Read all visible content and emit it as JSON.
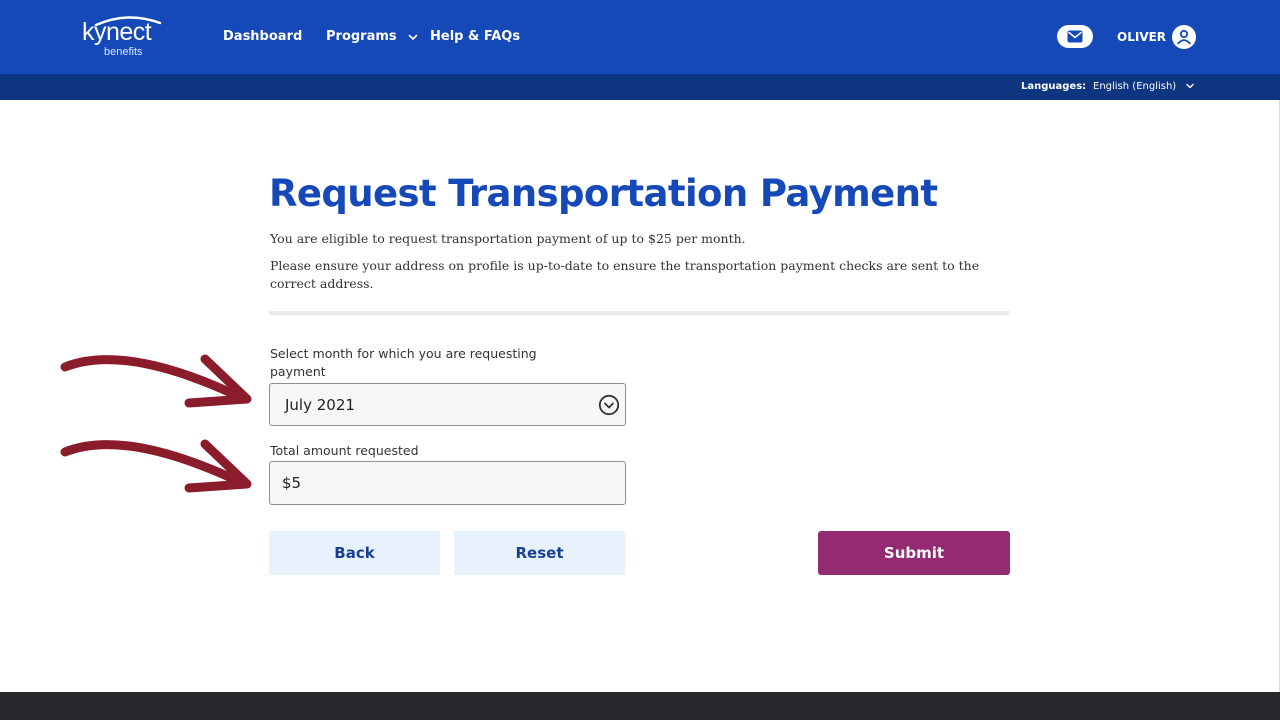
{
  "brand": {
    "name": "kynect",
    "sub": "benefits"
  },
  "nav": {
    "dashboard": "Dashboard",
    "programs": "Programs",
    "help": "Help & FAQs"
  },
  "user": {
    "name": "OLIVER"
  },
  "language": {
    "label": "Languages:",
    "selected": "English (English)"
  },
  "page": {
    "title": "Request Transportation Payment",
    "description_1": "You are eligible to request transportation payment of up to $25 per month.",
    "description_2": "Please ensure your address on profile is up-to-date to ensure the transportation payment checks are sent to the correct address."
  },
  "form": {
    "month_label": "Select month for which you are requesting payment",
    "month_value": "July 2021",
    "amount_label": "Total amount requested",
    "amount_value": "$5"
  },
  "buttons": {
    "back": "Back",
    "reset": "Reset",
    "submit": "Submit"
  },
  "colors": {
    "header_blue": "#1549b8",
    "language_bar": "#0d3580",
    "title_blue": "#1549b8",
    "submit_purple": "#932a72",
    "secondary_button_bg": "#e8f2fc",
    "annotation_arrow": "#8b1c2c",
    "footer": "#27292d"
  }
}
